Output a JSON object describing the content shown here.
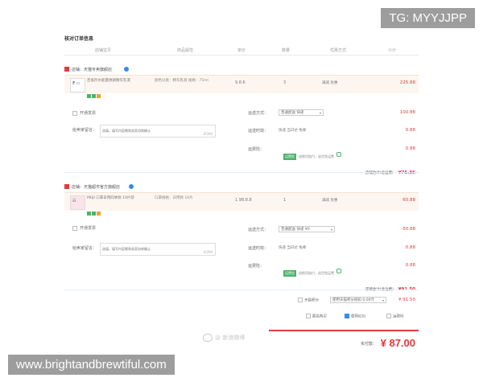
{
  "page": {
    "title": "核对订单信息"
  },
  "columns": [
    "店铺宝贝",
    "商品属性",
    "单价",
    "数量",
    "优惠方式",
    "小计"
  ],
  "stores": [
    {
      "name": "店铺：天猫专卖旗舰店",
      "item": {
        "name": "百雀羚水能量焕颜精华乳液",
        "spec": "颜色分类：精华乳液 规格：75ml",
        "price": "9.8.6",
        "qty": "3",
        "promo": "满减 优惠",
        "subtotal": "225.88"
      },
      "option_label": "开通发票",
      "message_label": "给卖家留言：",
      "message_placeholder": "选填，填写内容需和卖家协商确认",
      "message_counter": "0/200",
      "shipping": {
        "label": "运送方式：",
        "value": "普通配送 快递",
        "fee": "100.88"
      },
      "delivery": {
        "label": "运送时效：",
        "text": "快递 当日达 免邮",
        "fee": "0.88"
      },
      "insurance": {
        "label": "运费险：",
        "button": "运费险",
        "text": "退换货赔付，退货免运费",
        "fee": "0.88"
      },
      "store_total_label": "店铺合计(含运费)",
      "store_total": "¥75.85"
    },
    {
      "name": "店铺：天猫超市官方旗舰店",
      "item": {
        "name": "MUJI 口罩日用四季款 10片装",
        "spec": "口罩规格：日用款 10片",
        "price": "1 98.8.8",
        "qty": "1",
        "promo": "满减 优惠",
        "subtotal": "60.88"
      },
      "option_label": "开通发票",
      "message_label": "给卖家留言：",
      "message_placeholder": "选填，填写内容需和卖家协商确认",
      "message_counter": "0/200",
      "shipping": {
        "label": "运送方式：",
        "value": "普通配送 快递 ¥0",
        "fee": "-50.88"
      },
      "delivery": {
        "label": "运送时效：",
        "text": "快递 当日达 免邮",
        "fee": "0.88"
      },
      "insurance": {
        "label": "运费险：",
        "button": "运费险",
        "text": "退换货赔付，退货免运费",
        "fee": "0.88"
      },
      "store_total_label": "店铺合计(含运费)",
      "store_total": "¥91.50"
    }
  ],
  "summary": {
    "coupon_label": "天猫积分",
    "coupon_value": "使用天猫积分抵扣 0.00元",
    "coupon_amount": "¥ 91.50",
    "checkbox_a": "匿名购买",
    "checkbox_b": "使用红包",
    "checkbox_c": "运费险",
    "total_label": "实付款：",
    "total_value": "¥ 87.00"
  },
  "watermarks": {
    "center": "@ 新浪微博",
    "tg": "TG: MYYJJPP",
    "site": "www.brightandbrewtiful.com"
  },
  "colors": {
    "accent": "#e4393c",
    "link": "#3a8be3",
    "green": "#49b36b",
    "item_bg": "#fdf6f0"
  }
}
